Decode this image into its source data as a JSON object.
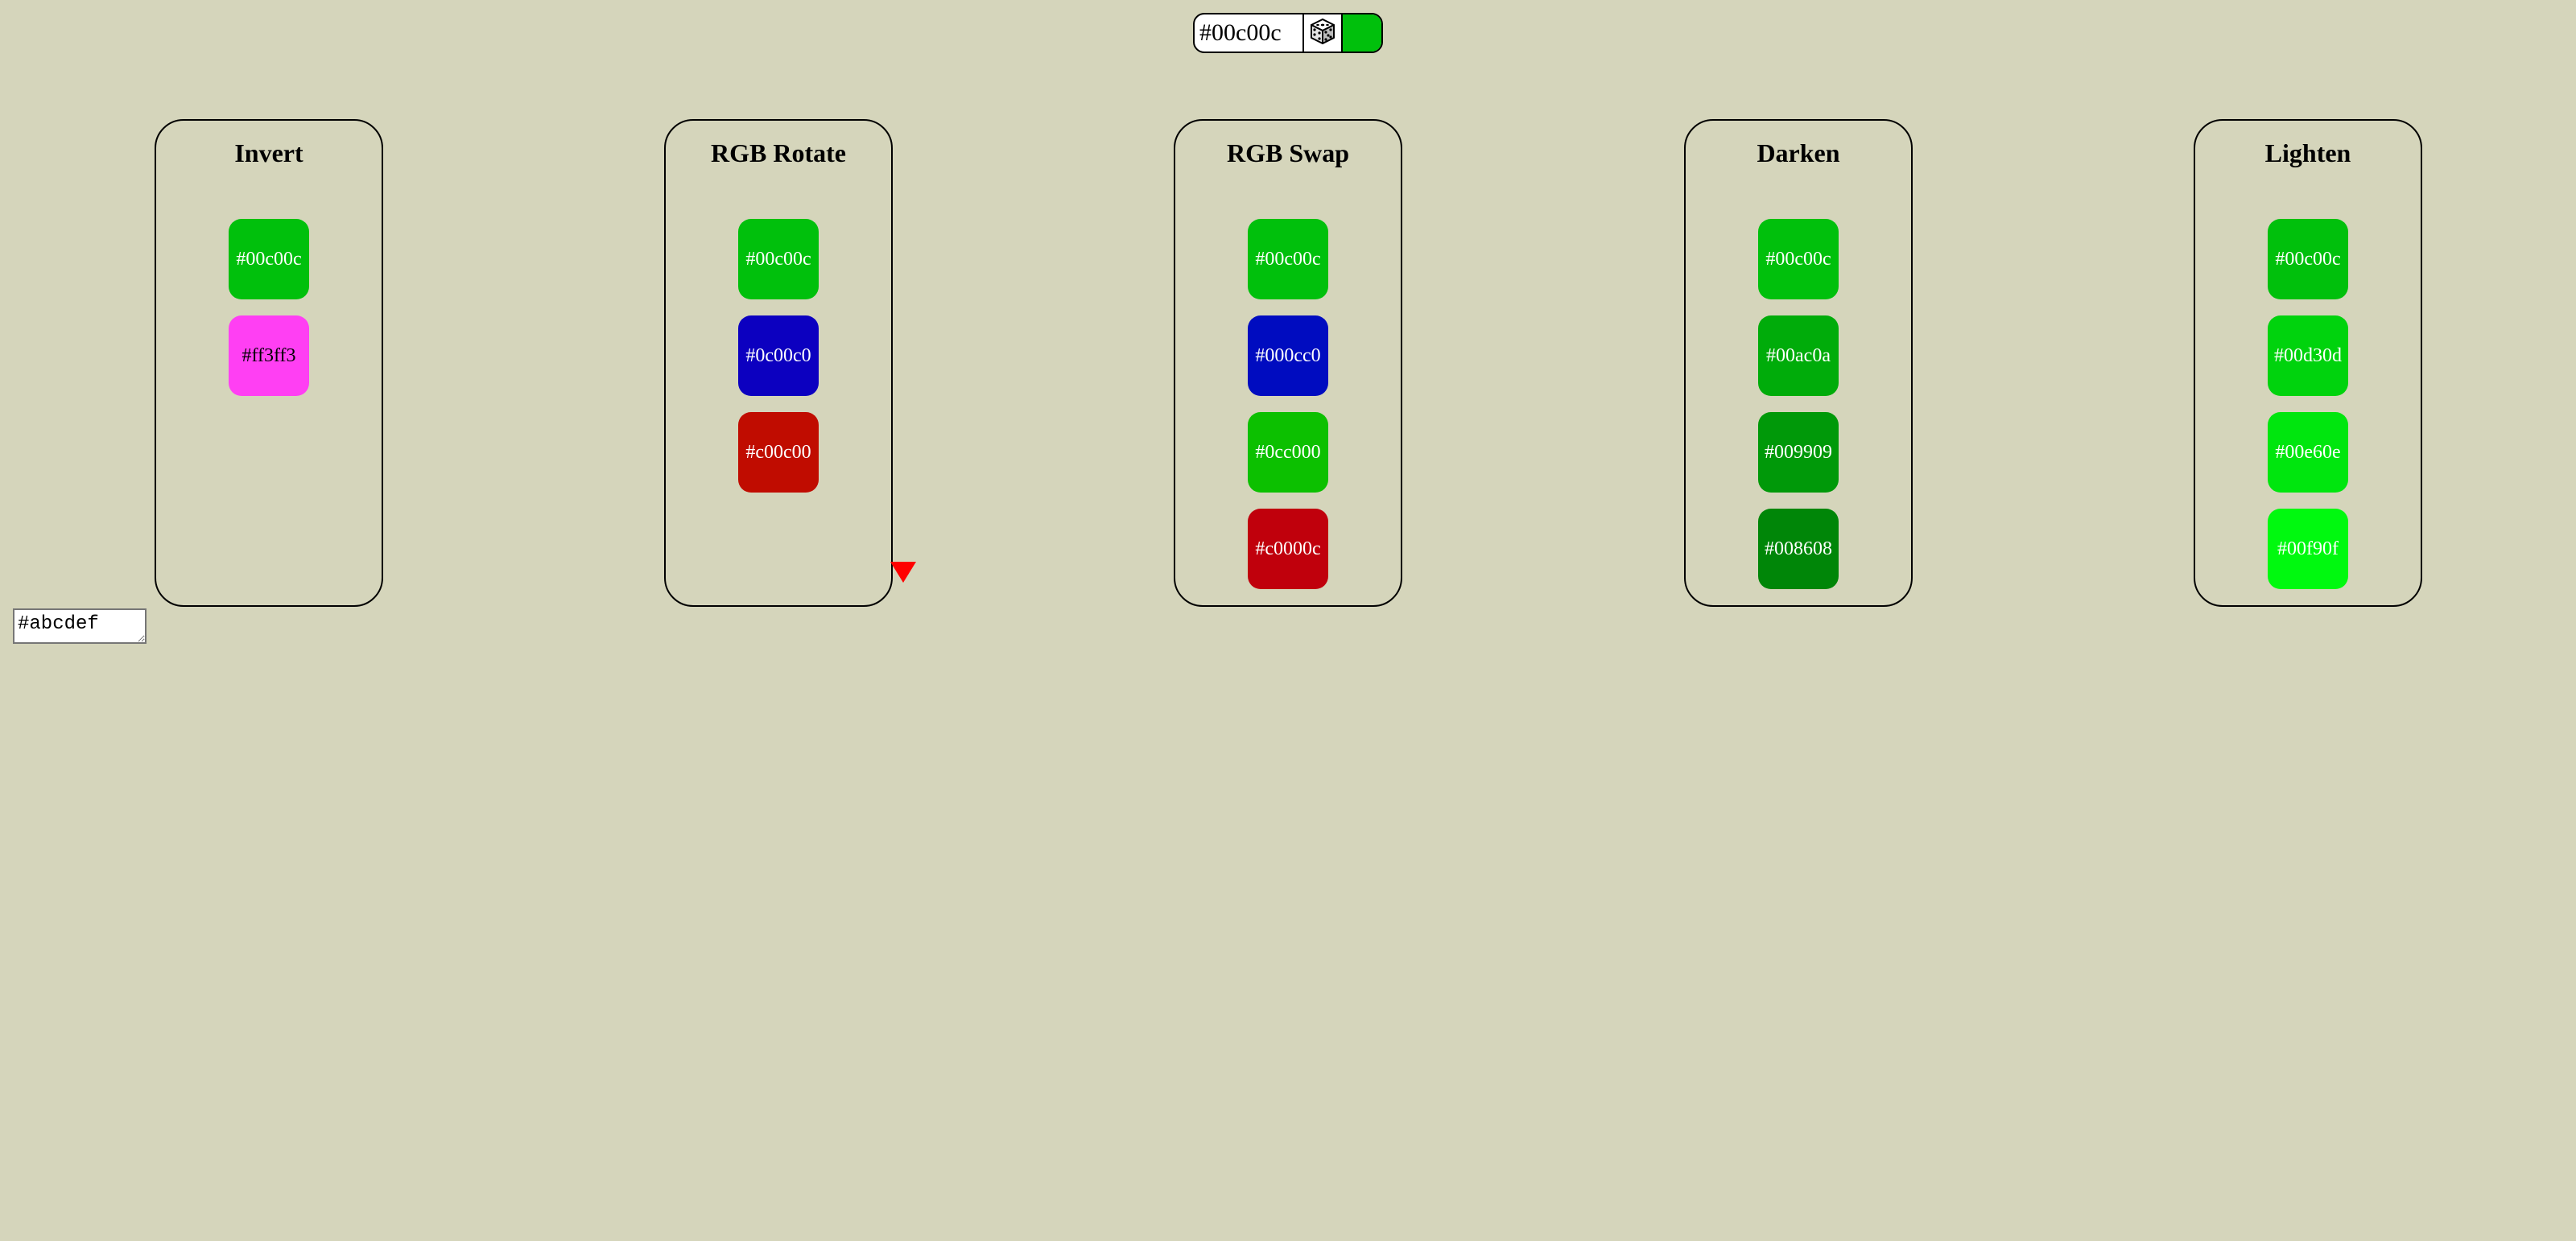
{
  "picker": {
    "value": "#00c00c",
    "random_icon": "dice-icon",
    "swatch_color": "#00c00c"
  },
  "panels": [
    {
      "title": "Invert",
      "swatches": [
        {
          "label": "#00c00c",
          "color": "#00c00c",
          "text_color": "#ffffff"
        },
        {
          "label": "#ff3ff3",
          "color": "#ff3ff3",
          "text_color": "#000000"
        }
      ]
    },
    {
      "title": "RGB Rotate",
      "swatches": [
        {
          "label": "#00c00c",
          "color": "#00c00c",
          "text_color": "#ffffff"
        },
        {
          "label": "#0c00c0",
          "color": "#0c00c0",
          "text_color": "#ffffff"
        },
        {
          "label": "#c00c00",
          "color": "#c00c00",
          "text_color": "#ffffff"
        }
      ]
    },
    {
      "title": "RGB Swap",
      "swatches": [
        {
          "label": "#00c00c",
          "color": "#00c00c",
          "text_color": "#ffffff"
        },
        {
          "label": "#000cc0",
          "color": "#000cc0",
          "text_color": "#ffffff"
        },
        {
          "label": "#0cc000",
          "color": "#0cc000",
          "text_color": "#ffffff"
        },
        {
          "label": "#c0000c",
          "color": "#c0000c",
          "text_color": "#ffffff"
        }
      ]
    },
    {
      "title": "Darken",
      "swatches": [
        {
          "label": "#00c00c",
          "color": "#00c00c",
          "text_color": "#ffffff"
        },
        {
          "label": "#00ac0a",
          "color": "#00ac0a",
          "text_color": "#ffffff"
        },
        {
          "label": "#009909",
          "color": "#009909",
          "text_color": "#ffffff"
        },
        {
          "label": "#008608",
          "color": "#008608",
          "text_color": "#ffffff"
        }
      ]
    },
    {
      "title": "Lighten",
      "swatches": [
        {
          "label": "#00c00c",
          "color": "#00c00c",
          "text_color": "#ffffff"
        },
        {
          "label": "#00d30d",
          "color": "#00d30d",
          "text_color": "#ffffff"
        },
        {
          "label": "#00e60e",
          "color": "#00e60e",
          "text_color": "#ffffff"
        },
        {
          "label": "#00f90f",
          "color": "#00f90f",
          "text_color": "#ffffff"
        }
      ]
    }
  ],
  "textarea": {
    "value": "#abcdef"
  },
  "colors": {
    "background": "#d5d5bb",
    "marker": "#ff0000"
  }
}
